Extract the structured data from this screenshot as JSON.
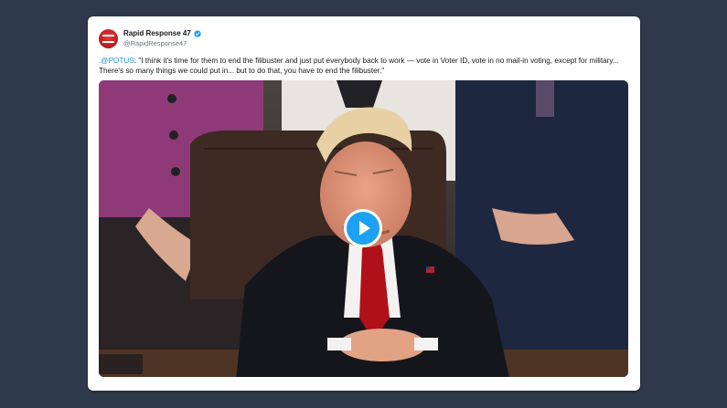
{
  "tweet": {
    "display_name": "Rapid Response 47",
    "handle": "@RapidResponse47",
    "verified": true,
    "mention": ".@POTUS",
    "text": ": \"I think it's time for them to end the filibuster and just put everybody back to work — vote in Voter ID, vote in no mail-in voting, except for military... There's so many things we could put in... but to do that, you have to end the filibuster.\""
  },
  "media": {
    "type": "video",
    "play_icon": "play-icon"
  },
  "colors": {
    "background": "#2e3a4b",
    "card": "#ffffff",
    "accent": "#1da1f2",
    "mention": "#1b95e0",
    "avatar": "#c42020"
  }
}
